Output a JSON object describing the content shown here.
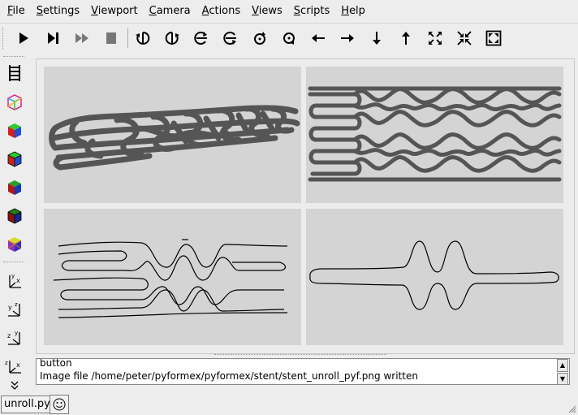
{
  "menu": [
    {
      "key": "F",
      "rest": "ile"
    },
    {
      "key": "S",
      "rest": "ettings"
    },
    {
      "key": "V",
      "rest": "iewport"
    },
    {
      "key": "C",
      "rest": "amera"
    },
    {
      "key": "A",
      "rest": "ctions"
    },
    {
      "key": "V",
      "rest": "iews"
    },
    {
      "key": "S",
      "rest": "cripts"
    },
    {
      "key": "H",
      "rest": "elp"
    }
  ],
  "toolbar": {
    "icons": [
      "play-icon",
      "step-icon",
      "continue-icon",
      "stop-icon",
      "rotate-left-icon",
      "rotate-right-icon",
      "rotate-up-icon",
      "rotate-down-icon",
      "rotate-ccw-icon",
      "rotate-cw-icon",
      "pan-left-icon",
      "pan-right-icon",
      "pan-down-icon",
      "pan-up-icon",
      "zoom-in-icon",
      "zoom-out-icon",
      "zoom-all-icon"
    ]
  },
  "left_toolbar": {
    "icons": [
      "ladder-icon",
      "wireframe-icon",
      "smooth-icon",
      "smooth-wire-icon",
      "flat-icon",
      "flat-wire-icon",
      "transparency-icon",
      "axes-x-icon",
      "axes-y-icon",
      "axes-z-icon",
      "axes-z2-icon"
    ]
  },
  "messages": {
    "line1": "button",
    "line2": "Image file /home/peter/pyformex/pyformex/stent/stent_unroll_pyf.png written"
  },
  "status": {
    "script": "unroll.py"
  },
  "colors": {
    "viewport_bg": "#d4d4d4",
    "mesh": "#555555"
  }
}
